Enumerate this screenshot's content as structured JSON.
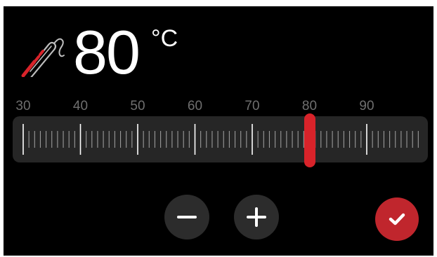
{
  "display": {
    "temperature": "80",
    "unit": "°C",
    "probe_icon": "meat-probe-icon"
  },
  "slider": {
    "min": 30,
    "max": 100,
    "value": 80,
    "labels": [
      "30",
      "40",
      "50",
      "60",
      "70",
      "80",
      "90"
    ]
  },
  "controls": {
    "decrease_icon": "minus-icon",
    "increase_icon": "plus-icon",
    "confirm_icon": "check-icon"
  },
  "colors": {
    "accent": "#d8232a",
    "background": "#000000",
    "track": "#262626",
    "button": "#2c2c2c",
    "label": "#6f6f6f"
  }
}
